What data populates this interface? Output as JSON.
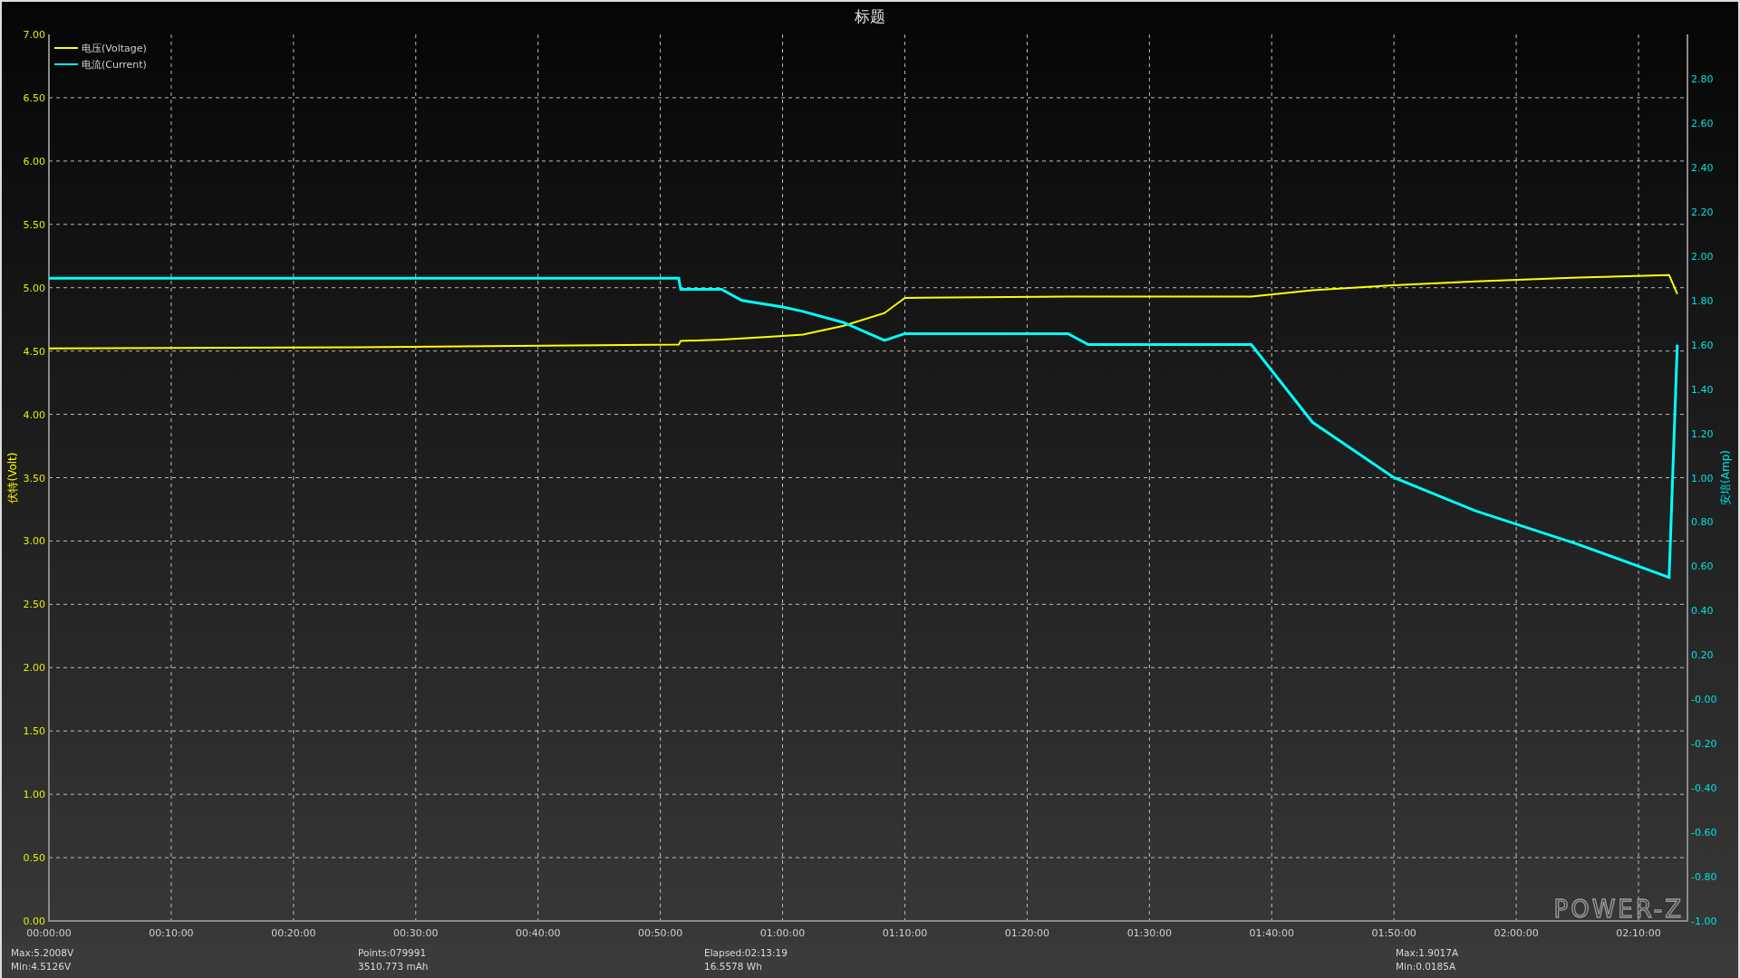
{
  "chart_data": {
    "type": "line",
    "title": "标题",
    "grid": true,
    "legend": "upper left",
    "ylabel": "伏特(Volt)",
    "y2label": "安培(Amp)",
    "xlim": [
      0,
      8040
    ],
    "ylim": [
      0,
      7
    ],
    "y2lim": [
      -1,
      3
    ],
    "xticks": [
      {
        "value": 0,
        "label": "00:00:00"
      },
      {
        "value": 600,
        "label": "00:10:00"
      },
      {
        "value": 1200,
        "label": "00:20:00"
      },
      {
        "value": 1800,
        "label": "00:30:00"
      },
      {
        "value": 2400,
        "label": "00:40:00"
      },
      {
        "value": 3000,
        "label": "00:50:00"
      },
      {
        "value": 3600,
        "label": "01:00:00"
      },
      {
        "value": 4200,
        "label": "01:10:00"
      },
      {
        "value": 4800,
        "label": "01:20:00"
      },
      {
        "value": 5400,
        "label": "01:30:00"
      },
      {
        "value": 6000,
        "label": "01:40:00"
      },
      {
        "value": 6600,
        "label": "01:50:00"
      },
      {
        "value": 7200,
        "label": "02:00:00"
      },
      {
        "value": 7800,
        "label": "02:10:00"
      }
    ],
    "yticks": [
      {
        "value": 0,
        "label": "0.00"
      },
      {
        "value": 0.5,
        "label": "0.50"
      },
      {
        "value": 1,
        "label": "1.00"
      },
      {
        "value": 1.5,
        "label": "1.50"
      },
      {
        "value": 2,
        "label": "2.00"
      },
      {
        "value": 2.5,
        "label": "2.50"
      },
      {
        "value": 3,
        "label": "3.00"
      },
      {
        "value": 3.5,
        "label": "3.50"
      },
      {
        "value": 4,
        "label": "4.00"
      },
      {
        "value": 4.5,
        "label": "4.50"
      },
      {
        "value": 5,
        "label": "5.00"
      },
      {
        "value": 5.5,
        "label": "5.50"
      },
      {
        "value": 6,
        "label": "6.00"
      },
      {
        "value": 6.5,
        "label": "6.50"
      },
      {
        "value": 7,
        "label": "7.00"
      }
    ],
    "y2ticks": [
      {
        "value": -1,
        "label": "-1.00"
      },
      {
        "value": -0.8,
        "label": "-0.80"
      },
      {
        "value": -0.6,
        "label": "-0.60"
      },
      {
        "value": -0.4,
        "label": "-0.40"
      },
      {
        "value": -0.2,
        "label": "-0.20"
      },
      {
        "value": 0,
        "label": "-0.00"
      },
      {
        "value": 0.2,
        "label": "0.20"
      },
      {
        "value": 0.4,
        "label": "0.40"
      },
      {
        "value": 0.6,
        "label": "0.60"
      },
      {
        "value": 0.8,
        "label": "0.80"
      },
      {
        "value": 1,
        "label": "1.00"
      },
      {
        "value": 1.2,
        "label": "1.20"
      },
      {
        "value": 1.4,
        "label": "1.40"
      },
      {
        "value": 1.6,
        "label": "1.60"
      },
      {
        "value": 1.8,
        "label": "1.80"
      },
      {
        "value": 2,
        "label": "2.00"
      },
      {
        "value": 2.2,
        "label": "2.20"
      },
      {
        "value": 2.4,
        "label": "2.40"
      },
      {
        "value": 2.6,
        "label": "2.60"
      },
      {
        "value": 2.8,
        "label": "2.80"
      }
    ],
    "x": [
      0,
      1500,
      3090,
      3100,
      3300,
      3400,
      3600,
      3700,
      3900,
      4100,
      4200,
      5000,
      5100,
      5400,
      5900,
      6200,
      6600,
      7000,
      7500,
      7950,
      7990
    ],
    "series": [
      {
        "name": "电压(Voltage)",
        "color": "#ffff00",
        "values": [
          4.52,
          4.53,
          4.55,
          4.58,
          4.59,
          4.6,
          4.62,
          4.63,
          4.7,
          4.8,
          4.92,
          4.93,
          4.93,
          4.93,
          4.93,
          4.98,
          5.02,
          5.05,
          5.08,
          5.1,
          4.95
        ]
      },
      {
        "name": "电流(Current)",
        "color": "#00ffff",
        "axis": "y2",
        "values": [
          1.9,
          1.9,
          1.9,
          1.85,
          1.85,
          1.8,
          1.77,
          1.75,
          1.7,
          1.62,
          1.65,
          1.65,
          1.6,
          1.6,
          1.6,
          1.25,
          1.0,
          0.85,
          0.7,
          0.55,
          1.6
        ]
      }
    ]
  },
  "logo": "POWER-Z",
  "stats": [
    [
      "Max:5.2008V",
      "Min:4.5126V"
    ],
    [
      "Points:079991",
      "3510.773 mAh"
    ],
    [
      "Elapsed:02:13:19",
      "16.5578 Wh"
    ],
    [
      "Max:1.9017A",
      "Min:0.0185A"
    ]
  ]
}
